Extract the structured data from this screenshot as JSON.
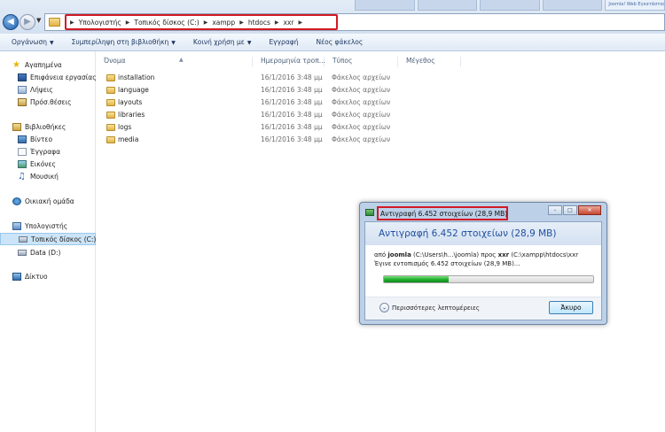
{
  "address_bar": {
    "crumbs": [
      "Υπολογιστής",
      "Τοπικός δίσκος (C:)",
      "xampp",
      "htdocs",
      "xxr"
    ],
    "tabs": [
      "",
      "",
      "",
      "",
      "Joomla! Web Εγκατάσταση"
    ]
  },
  "toolbar": {
    "organize": "Οργάνωση",
    "include_library": "Συμπερίληψη στη βιβλιοθήκη",
    "share_with": "Κοινή χρήση με",
    "burn": "Εγγραφή",
    "new_folder": "Νέος φάκελος"
  },
  "nav": {
    "favorites": "Αγαπημένα",
    "desktop": "Επιφάνεια εργασίας",
    "downloads": "Λήψεις",
    "recent": "Πρόσ.θέσεις",
    "libraries": "Βιβλιοθήκες",
    "videos": "Βίντεο",
    "documents": "Έγγραφα",
    "pictures": "Εικόνες",
    "music": "Μουσική",
    "homegroup": "Οικιακή ομάδα",
    "computer": "Υπολογιστής",
    "local_disk": "Τοπικός δίσκος (C:)",
    "data_disk": "Data (D:)",
    "network": "Δίκτυο"
  },
  "columns": {
    "name": "Όνομα",
    "date": "Ημερομηνία τροπ...",
    "type": "Τύπος",
    "size": "Μέγεθος"
  },
  "files": [
    {
      "name": "installation",
      "date": "16/1/2016 3:48 μμ",
      "type": "Φάκελος αρχείων"
    },
    {
      "name": "language",
      "date": "16/1/2016 3:48 μμ",
      "type": "Φάκελος αρχείων"
    },
    {
      "name": "layouts",
      "date": "16/1/2016 3:48 μμ",
      "type": "Φάκελος αρχείων"
    },
    {
      "name": "libraries",
      "date": "16/1/2016 3:48 μμ",
      "type": "Φάκελος αρχείων"
    },
    {
      "name": "logs",
      "date": "16/1/2016 3:48 μμ",
      "type": "Φάκελος αρχείων"
    },
    {
      "name": "media",
      "date": "16/1/2016 3:48 μμ",
      "type": "Φάκελος αρχείων"
    }
  ],
  "dialog": {
    "title": "Αντιγραφή 6.452 στοιχείων (28,9 MB)",
    "heading": "Αντιγραφή 6.452 στοιχείων (28,9 MB)",
    "from_prefix": "από",
    "from_source": "joomla",
    "from_path": "(C:\\Users\\h...\\joomla) προς",
    "to_target": "xxr",
    "to_path": "(C:\\xampp\\htdocs\\xxr",
    "status": "Έγινε εντοπισμός 6.452 στοιχείων (28,9 MB)...",
    "progress": 0.31,
    "more_details": "Περισσότερες λεπτομέρειες",
    "cancel": "Άκυρο"
  }
}
